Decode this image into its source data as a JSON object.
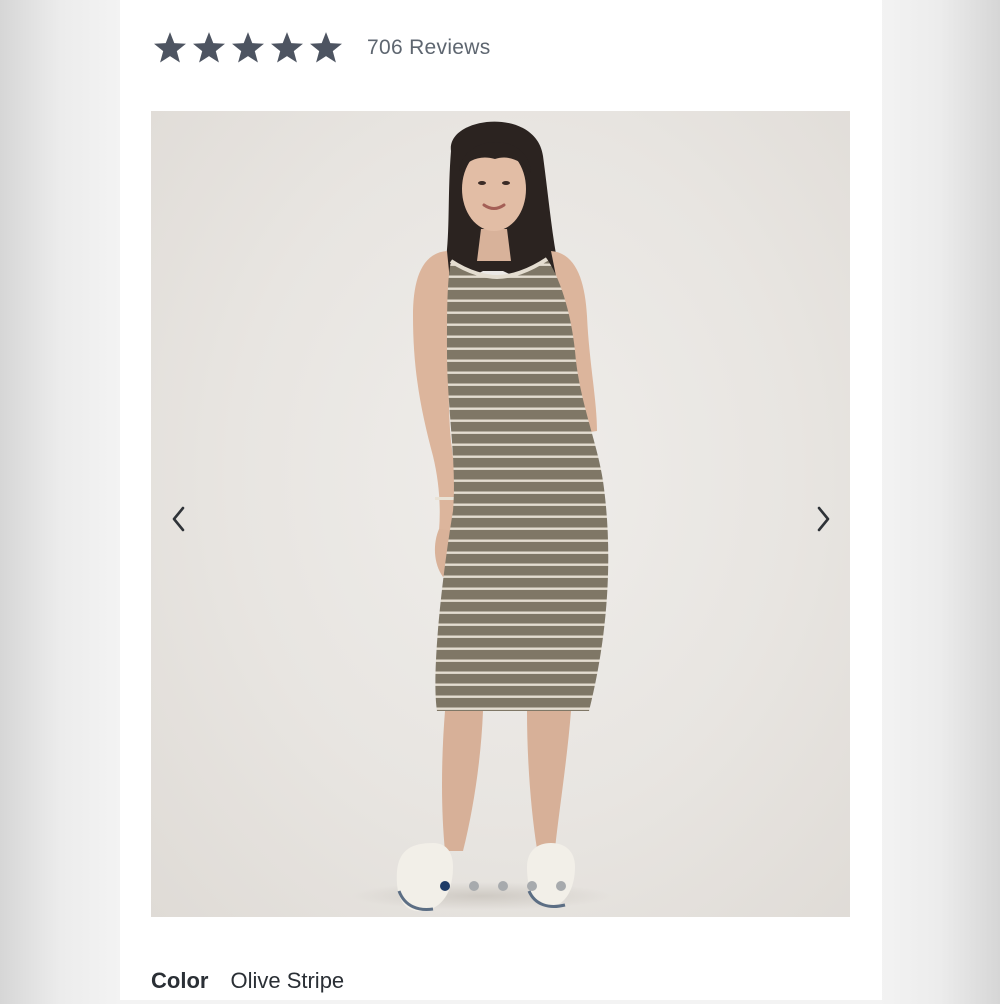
{
  "rating": {
    "stars": 5,
    "max_stars": 5,
    "star_color": "#4d5461",
    "reviews_label": "706 Reviews"
  },
  "gallery": {
    "image_description_icon": "product-photo",
    "prev_icon": "chevron-left-icon",
    "next_icon": "chevron-right-icon",
    "dot_count": 5,
    "active_dot": 0,
    "active_dot_color": "#1e3b66",
    "inactive_dot_color": "#a7aaad"
  },
  "color": {
    "label": "Color",
    "value": "Olive Stripe"
  }
}
